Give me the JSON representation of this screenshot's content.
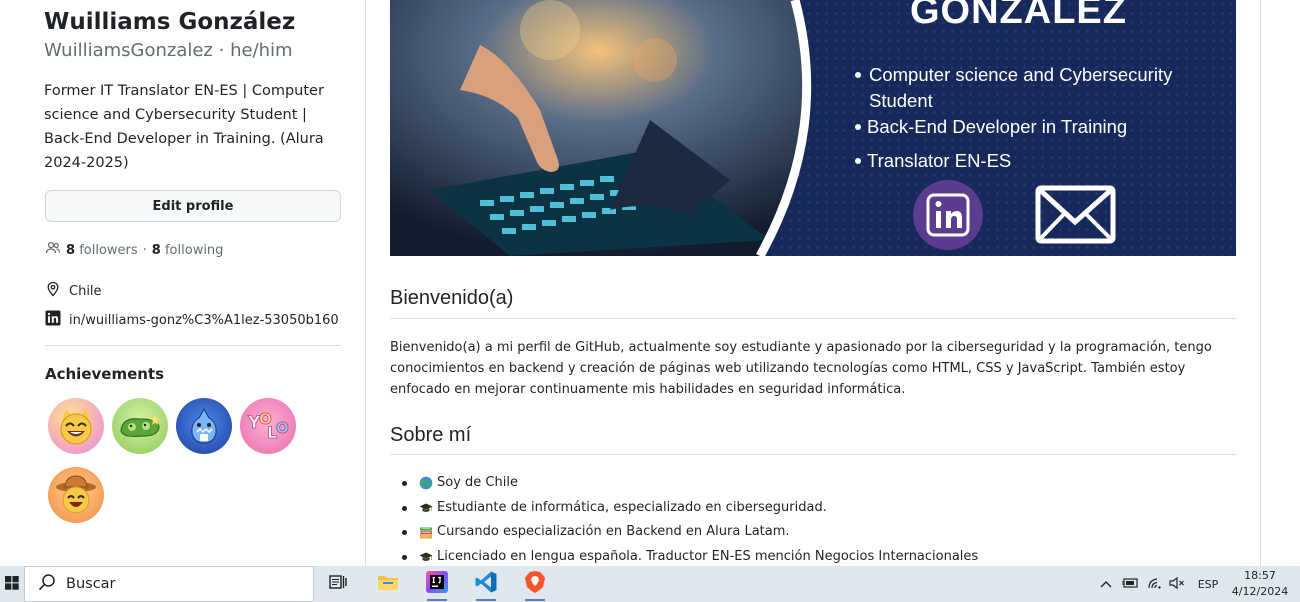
{
  "profile": {
    "name": "Wuilliams González",
    "handle": "WuilliamsGonzalez",
    "pronouns": "he/him",
    "bio": "Former IT Translator EN-ES | Computer science and Cybersecurity Student | Back-End Developer in Training. (Alura 2024-2025)",
    "edit_button": "Edit profile",
    "followers_count": "8",
    "followers_label": "followers",
    "following_count": "8",
    "following_label": "following",
    "separator": "·",
    "location": "Chile",
    "linkedin": "in/wuilliams-gonz%C3%A1lez-53050b160",
    "achievements_title": "Achievements",
    "achievements": [
      {
        "icon": "quickdraw-cat-badge-icon",
        "color": "#f6a6c8"
      },
      {
        "icon": "pair-extraordinaire-badge-icon",
        "color": "#bfe39a"
      },
      {
        "icon": "pull-shark-badge-icon",
        "color": "#3b6fd6"
      },
      {
        "icon": "yolo-badge-icon",
        "color": "#f29ac7"
      },
      {
        "icon": "starstruck-cowboy-badge-icon",
        "color": "#f6a56c"
      }
    ]
  },
  "banner": {
    "title": "GONZÁLEZ",
    "items": [
      "Computer science and Cybersecurity",
      "Student",
      "Back-End Developer in Training",
      "Translator EN-ES"
    ],
    "colors": {
      "background": "#17295a",
      "ring": "#ffffff"
    }
  },
  "readme": {
    "welcome_heading": "Bienvenido(a)",
    "welcome_text": "Bienvenido(a) a mi perfil de GitHub, actualmente soy estudiante y apasionado por la ciberseguridad y la programación, tengo conocimientos en backend y creación de páginas web utilizando tecnologías como HTML, CSS y JavaScript. También estoy enfocado en mejorar continuamente mis habilidades en seguridad informática.",
    "about_heading": "Sobre mí",
    "about_items": [
      {
        "icon": "globe-icon",
        "text": "Soy de Chile"
      },
      {
        "icon": "graduation-cap-icon",
        "text": "Estudiante de informática, especializado en ciberseguridad."
      },
      {
        "icon": "books-icon",
        "text": "Cursando especialización en Backend en Alura Latam."
      },
      {
        "icon": "graduation-cap-icon",
        "text": "Licenciado en lengua española. Traductor EN-ES mención Negocios Internacionales"
      }
    ]
  },
  "taskbar": {
    "search_placeholder": "Buscar",
    "apps": [
      "task-view-icon",
      "file-explorer-icon",
      "intellij-icon",
      "vscode-icon",
      "brave-icon"
    ],
    "language": "ESP",
    "time": "18:57",
    "date": "4/12/2024",
    "accent": "#dfe8ef"
  }
}
